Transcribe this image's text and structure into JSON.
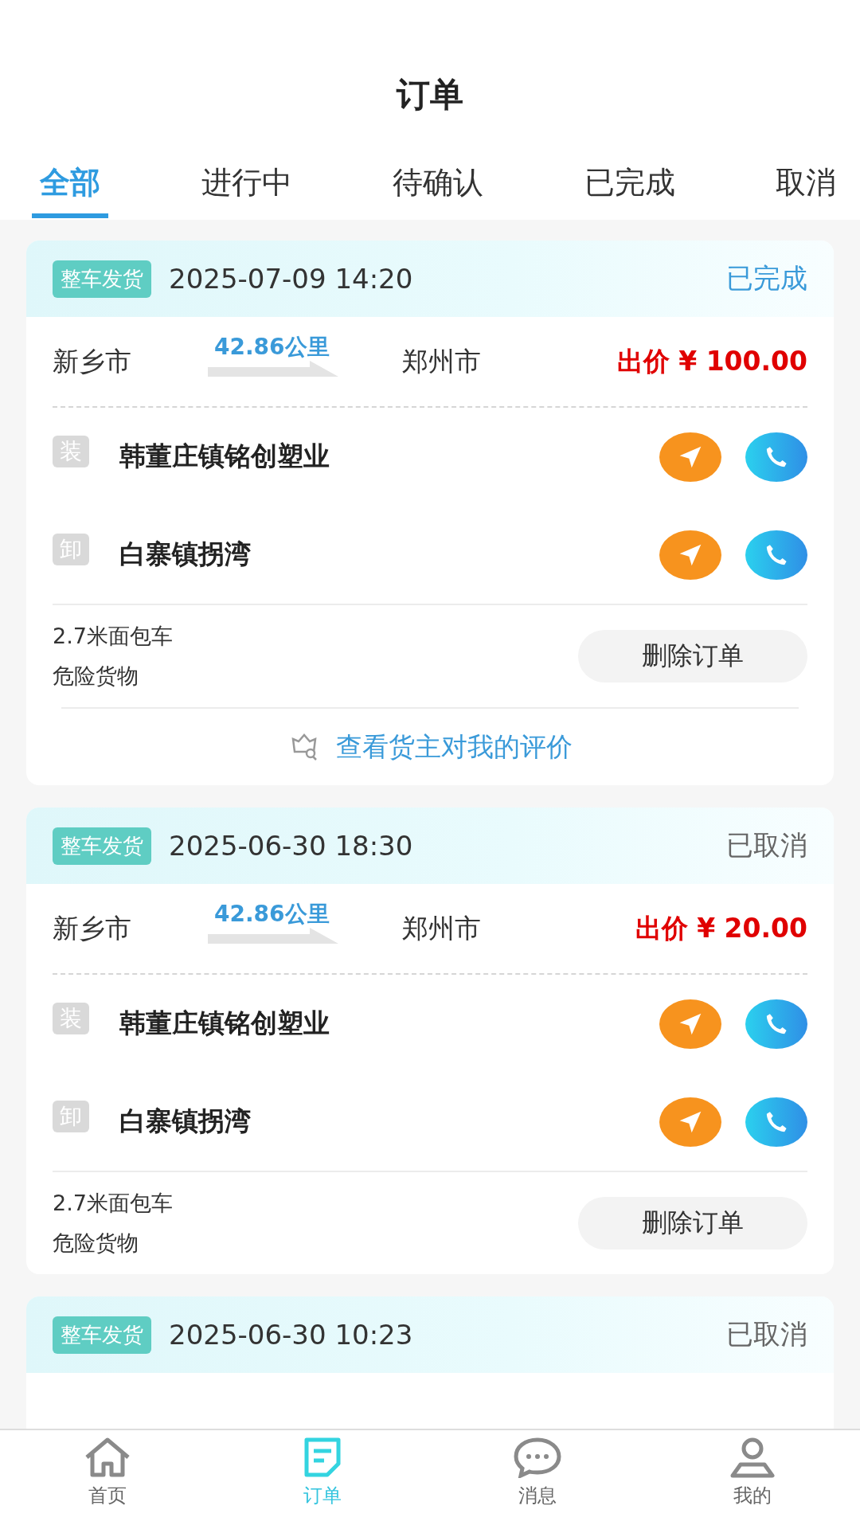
{
  "header": {
    "title": "订单"
  },
  "tabs": [
    {
      "label": "全部",
      "selected": true
    },
    {
      "label": "进行中",
      "selected": false
    },
    {
      "label": "待确认",
      "selected": false
    },
    {
      "label": "已完成",
      "selected": false
    },
    {
      "label": "取消",
      "selected": false
    }
  ],
  "orders": [
    {
      "tag": "整车发货",
      "time": "2025-07-09 14:20",
      "status": {
        "text": "已完成",
        "kind": "done"
      },
      "origin": "新乡市",
      "distance": "42.86公里",
      "destination": "郑州市",
      "price": "出价 ¥ 100.00",
      "stops": [
        {
          "badge": "装",
          "name": "韩董庄镇铭创塑业"
        },
        {
          "badge": "卸",
          "name": "白寨镇拐湾"
        }
      ],
      "vehicle": "2.7米面包车",
      "cargo": "危险货物",
      "action": "删除订单",
      "review": "查看货主对我的评价"
    },
    {
      "tag": "整车发货",
      "time": "2025-06-30 18:30",
      "status": {
        "text": "已取消",
        "kind": "cancelled"
      },
      "origin": "新乡市",
      "distance": "42.86公里",
      "destination": "郑州市",
      "price": "出价 ¥ 20.00",
      "stops": [
        {
          "badge": "装",
          "name": "韩董庄镇铭创塑业"
        },
        {
          "badge": "卸",
          "name": "白寨镇拐湾"
        }
      ],
      "vehicle": "2.7米面包车",
      "cargo": "危险货物",
      "action": "删除订单"
    },
    {
      "tag": "整车发货",
      "time": "2025-06-30 10:23",
      "status": {
        "text": "已取消",
        "kind": "cancelled"
      }
    }
  ],
  "nav": [
    {
      "kind": "home",
      "label": "首页",
      "selected": false
    },
    {
      "kind": "orders",
      "label": "订单",
      "selected": true
    },
    {
      "kind": "messages",
      "label": "消息",
      "selected": false
    },
    {
      "kind": "profile",
      "label": "我的",
      "selected": false
    }
  ]
}
